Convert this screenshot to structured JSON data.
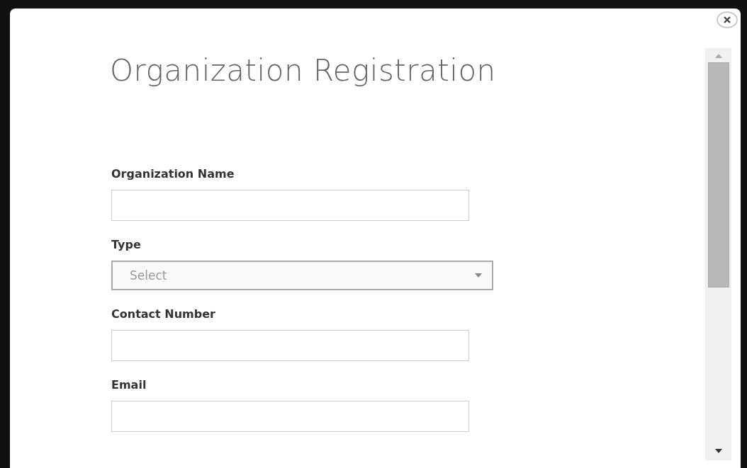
{
  "dialog": {
    "title": "Organization Registration"
  },
  "fields": [
    {
      "kind": "text",
      "label": "Organization Name"
    },
    {
      "kind": "select",
      "label": "Type",
      "placeholder": "Select"
    },
    {
      "kind": "text",
      "label": "Contact Number"
    },
    {
      "kind": "text",
      "label": "Email"
    }
  ]
}
